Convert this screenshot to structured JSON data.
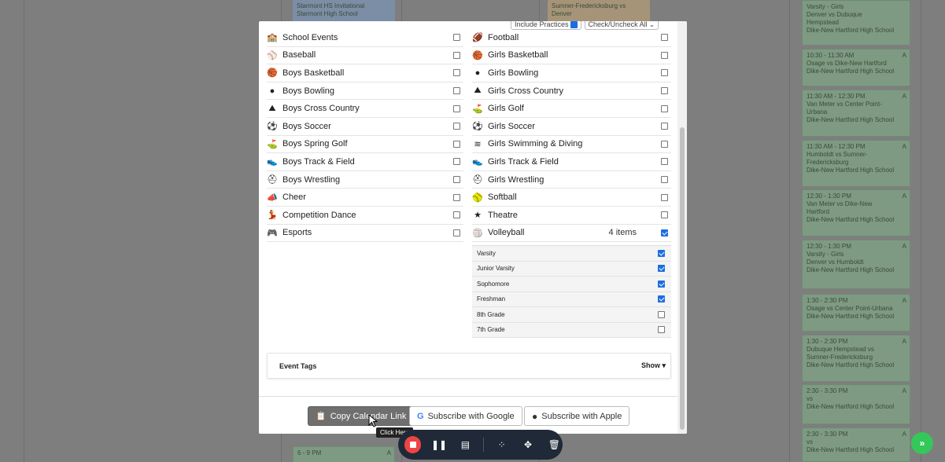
{
  "background": {
    "top_left_cards": [
      {
        "lines": [
          "Starmont HS Invitational",
          "Starmont High School"
        ]
      },
      {
        "lines": [
          "Sumner-Fredericksburg vs",
          "Denver"
        ]
      }
    ],
    "bottom_left_card": {
      "time": "6 - 9 PM",
      "badge": "A"
    },
    "right_cards": [
      {
        "lines": [
          "Varsity - Girls",
          "Denver vs Dubuque",
          "Hempstead",
          "Dike-New Hartford High School"
        ],
        "badge": ""
      },
      {
        "lines": [
          "10:30 - 11:30 AM",
          "Osage vs Dike-New Hartford",
          "Dike-New Hartford High School"
        ],
        "badge": "A"
      },
      {
        "lines": [
          "11:30 AM - 12:30 PM",
          "Van Meter vs Center Point-",
          "Urbana",
          "Dike-New Hartford High School"
        ],
        "badge": "A"
      },
      {
        "lines": [
          "11:30 AM - 12:30 PM",
          "Humboldt vs Sumner-",
          "Fredericksburg",
          "Dike-New Hartford High School"
        ],
        "badge": "A"
      },
      {
        "lines": [
          "12:30 - 1:30 PM",
          "Van Meter vs Dike-New",
          "Hartford",
          "Dike-New Hartford High School"
        ],
        "badge": "A"
      },
      {
        "lines": [
          "12:30 - 1:30 PM",
          "Varsity - Girls",
          "Denver vs Humboldt",
          "Dike-New Hartford High School"
        ],
        "badge": "A"
      },
      {
        "lines": [
          "1:30 - 2:30 PM",
          "Osage vs Center Point-Urbana",
          "Dike-New Hartford High School"
        ],
        "badge": "A"
      },
      {
        "lines": [
          "1:30 - 2:30 PM",
          "Dubuque Hempstead vs",
          "Sumner-Fredericksburg",
          "Dike-New Hartford High School"
        ],
        "badge": "A"
      },
      {
        "lines": [
          "2:30 - 3:30 PM",
          "vs",
          "Dike-New Hartford High School"
        ],
        "badge": "A"
      },
      {
        "lines": [
          "2:30 - 3:30 PM",
          "vs",
          "Dike-New Hartford High School"
        ],
        "badge": "A"
      }
    ]
  },
  "modal": {
    "include_practices_label": "Include Practices",
    "check_uncheck_label": "Check/Uncheck All",
    "left_items": [
      {
        "label": "School Events",
        "icon": "school-icon",
        "glyph": "🏫",
        "checked": false
      },
      {
        "label": "Baseball",
        "icon": "baseball-icon",
        "glyph": "⚾",
        "checked": false
      },
      {
        "label": "Boys Basketball",
        "icon": "basketball-icon",
        "glyph": "🏀",
        "checked": false
      },
      {
        "label": "Boys Bowling",
        "icon": "bowling-icon",
        "glyph": "●",
        "checked": false
      },
      {
        "label": "Boys Cross Country",
        "icon": "cross-country-icon",
        "glyph": "⛰",
        "checked": false
      },
      {
        "label": "Boys Soccer",
        "icon": "soccer-icon",
        "glyph": "⚽",
        "checked": false
      },
      {
        "label": "Boys Spring Golf",
        "icon": "golf-icon",
        "glyph": "⛳",
        "checked": false
      },
      {
        "label": "Boys Track & Field",
        "icon": "track-shoe-icon",
        "glyph": "👟",
        "checked": false
      },
      {
        "label": "Boys Wrestling",
        "icon": "wrestling-icon",
        "glyph": "⛑",
        "checked": false
      },
      {
        "label": "Cheer",
        "icon": "cheer-icon",
        "glyph": "📣",
        "checked": false
      },
      {
        "label": "Competition Dance",
        "icon": "dance-icon",
        "glyph": "💃",
        "checked": false
      },
      {
        "label": "Esports",
        "icon": "gamepad-icon",
        "glyph": "🎮",
        "checked": false
      }
    ],
    "right_items": [
      {
        "label": "Football",
        "icon": "football-icon",
        "glyph": "🏈",
        "checked": false
      },
      {
        "label": "Girls Basketball",
        "icon": "basketball-icon",
        "glyph": "🏀",
        "checked": false
      },
      {
        "label": "Girls Bowling",
        "icon": "bowling-icon",
        "glyph": "●",
        "checked": false
      },
      {
        "label": "Girls Cross Country",
        "icon": "cross-country-icon",
        "glyph": "⛰",
        "checked": false
      },
      {
        "label": "Girls Golf",
        "icon": "golf-icon",
        "glyph": "⛳",
        "checked": false
      },
      {
        "label": "Girls Soccer",
        "icon": "soccer-icon",
        "glyph": "⚽",
        "checked": false
      },
      {
        "label": "Girls Swimming & Diving",
        "icon": "swimming-icon",
        "glyph": "≋",
        "checked": false
      },
      {
        "label": "Girls Track & Field",
        "icon": "track-shoe-icon",
        "glyph": "👟",
        "checked": false
      },
      {
        "label": "Girls Wrestling",
        "icon": "wrestling-icon",
        "glyph": "⛑",
        "checked": false
      },
      {
        "label": "Softball",
        "icon": "softball-icon",
        "glyph": "🥎",
        "checked": false
      },
      {
        "label": "Theatre",
        "icon": "star-icon",
        "glyph": "★",
        "checked": false
      },
      {
        "label": "Volleyball",
        "icon": "volleyball-icon",
        "glyph": "🏐",
        "checked": true,
        "count": "4 items"
      }
    ],
    "volleyball_levels": [
      {
        "label": "Varsity",
        "checked": true
      },
      {
        "label": "Junior Varsity",
        "checked": true
      },
      {
        "label": "Sophomore",
        "checked": true
      },
      {
        "label": "Freshman",
        "checked": true
      },
      {
        "label": "8th Grade",
        "checked": false
      },
      {
        "label": "7th Grade",
        "checked": false
      }
    ],
    "event_tags_label": "Event Tags",
    "show_label": "Show",
    "copy_link_label": "Copy Calendar Link",
    "google_label": "Subscribe with Google",
    "apple_label": "Subscribe with Apple"
  },
  "tooltip": "Click Here",
  "colors": {
    "accent": "#1a6fe0",
    "record": "#ef4444",
    "fab": "#34c759"
  }
}
